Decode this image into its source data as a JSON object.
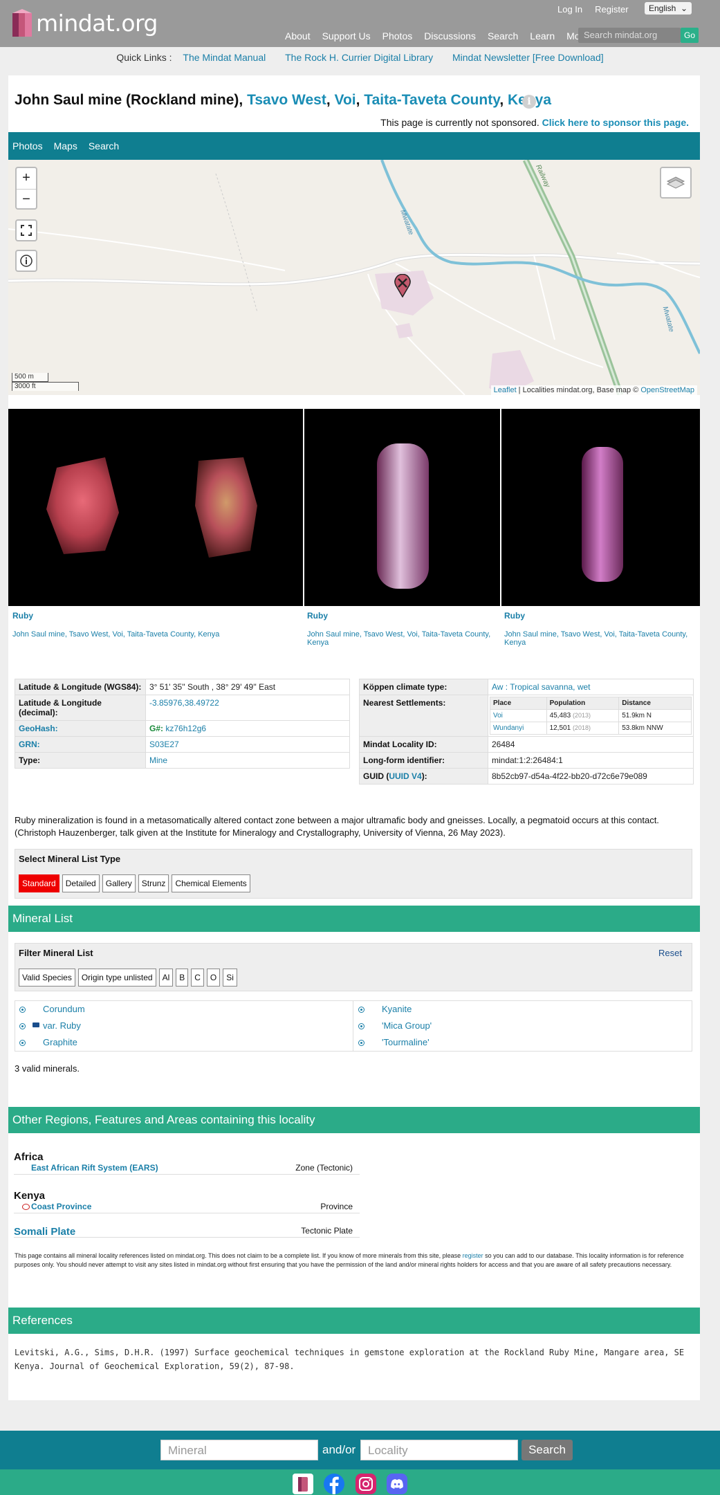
{
  "header": {
    "logo_text": "mindat.org",
    "login": "Log In",
    "register": "Register",
    "language": "English",
    "nav": [
      "About",
      "Support Us",
      "Photos",
      "Discussions",
      "Search",
      "Learn",
      "More"
    ],
    "search_placeholder": "Search mindat.org",
    "go": "Go"
  },
  "quicklinks": {
    "label": "Quick Links :",
    "links": [
      "The Mindat Manual",
      "The Rock H. Currier Digital Library",
      "Mindat Newsletter [Free Download]"
    ]
  },
  "title": {
    "name": "John Saul mine (Rockland mine),",
    "loc1": "Tsavo West",
    "loc2": "Voi",
    "loc3": "Taita-Taveta County",
    "loc4": "Kenya",
    "info": "i"
  },
  "sponsor": {
    "text": "This page is currently not sponsored.",
    "link": "Click here to sponsor this page."
  },
  "tabs": [
    "Photos",
    "Maps",
    "Search"
  ],
  "map": {
    "zoom_in": "+",
    "zoom_out": "−",
    "scale_m": "500 m",
    "scale_ft": "3000 ft",
    "attribution_leaflet": "Leaflet",
    "attribution_text": " | Localities mindat.org, Base map © ",
    "attribution_osm": "OpenStreetMap",
    "river_label": "Mwatate",
    "river_label2": "Mwatate",
    "rail_label": "Railway"
  },
  "photos": [
    {
      "mineral": "Ruby",
      "locality": "John Saul mine, Tsavo West, Voi, Taita-Taveta County, Kenya"
    },
    {
      "mineral": "Ruby",
      "locality": "John Saul mine, Tsavo West, Voi, Taita-Taveta County, Kenya"
    },
    {
      "mineral": "Ruby",
      "locality": "John Saul mine, Tsavo West, Voi, Taita-Taveta County, Kenya"
    }
  ],
  "loc_info": {
    "latlong_label": "Latitude & Longitude (WGS84):",
    "latlong_value": "3° 51' 35'' South , 38° 29' 49'' East",
    "latlong_dec_label": "Latitude & Longitude (decimal):",
    "latlong_dec_value": "-3.85976,38.49722",
    "geohash_label": "GeoHash:",
    "geohash_prefix": "G#:",
    "geohash_value": "kz76h12g6",
    "grn_label": "GRN:",
    "grn_value": "S03E27",
    "type_label": "Type:",
    "type_value": "Mine"
  },
  "loc_info_right": {
    "koppen_label": "Köppen climate type:",
    "koppen_value": "Aw : Tropical savanna, wet",
    "nearest_label": "Nearest Settlements:",
    "settlement_headers": [
      "Place",
      "Population",
      "Distance"
    ],
    "settlements": [
      {
        "place": "Voi",
        "population": "45,483",
        "year": "(2013)",
        "distance": "51.9km N"
      },
      {
        "place": "Wundanyi",
        "population": "12,501",
        "year": "(2018)",
        "distance": "53.8km NNW"
      }
    ],
    "locid_label": "Mindat Locality ID:",
    "locid_value": "26484",
    "longform_label": "Long-form identifier:",
    "longform_value": "mindat:1:2:26484:1",
    "guid_label_a": "GUID (",
    "guid_label_link": "UUID V4",
    "guid_label_b": "):",
    "guid_value": "8b52cb97-d54a-4f22-bb20-d72c6e79e089"
  },
  "description": "Ruby mineralization is found in a metasomatically altered contact zone between a major ultramafic body and gneisses. Locally, a pegmatoid occurs at this contact. (Christoph Hauzenberger, talk given at the Institute for Mineralogy and Crystallography, University of Vienna, 26 May 2023).",
  "mineral_list_type": {
    "title": "Select Mineral List Type",
    "buttons": [
      "Standard",
      "Detailed",
      "Gallery",
      "Strunz",
      "Chemical Elements"
    ]
  },
  "mineral_list_header": "Mineral List",
  "filter": {
    "title": "Filter Mineral List",
    "reset": "Reset",
    "buttons": [
      "Valid Species",
      "Origin type unlisted",
      "Al",
      "B",
      "C",
      "O",
      "Si"
    ]
  },
  "minerals_left": [
    "Corundum",
    "var. Ruby",
    "Graphite"
  ],
  "minerals_right": [
    "Kyanite",
    "'Mica Group'",
    "'Tourmaline'"
  ],
  "valid_count": "3 valid minerals.",
  "regions_header": "Other Regions, Features and Areas containing this locality",
  "regions": {
    "africa": "Africa",
    "ears": "East African Rift System (EARS)",
    "ears_type": "Zone (Tectonic)",
    "kenya": "Kenya",
    "coast": "Coast Province",
    "coast_type": "Province",
    "somali": "Somali Plate",
    "somali_type": "Tectonic Plate"
  },
  "disclaimer_a": "This page contains all mineral locality references listed on mindat.org. This does not claim to be a complete list. If you know of more minerals from this site, please ",
  "disclaimer_link": "register",
  "disclaimer_b": " so you can add to our database. This locality information is for reference purposes only. You should never attempt to visit any sites listed in mindat.org without first ensuring that you have the permission of the land and/or mineral rights holders for access and that you are aware of all safety precautions necessary.",
  "references_header": "References",
  "reference": "Levitski, A.G., Sims, D.H.R. (1997) Surface geochemical techniques in gemstone exploration at the Rockland Ruby Mine, Mangare area, SE Kenya. Journal of Geochemical Exploration, 59(2), 87-98.",
  "footer": {
    "mineral_placeholder": "Mineral",
    "andor": "and/or",
    "locality_placeholder": "Locality",
    "search": "Search"
  },
  "colors": {
    "teal": "#0f7e90",
    "green": "#2bab88",
    "link": "#1a7fa8",
    "header": "#9a9a9a"
  }
}
